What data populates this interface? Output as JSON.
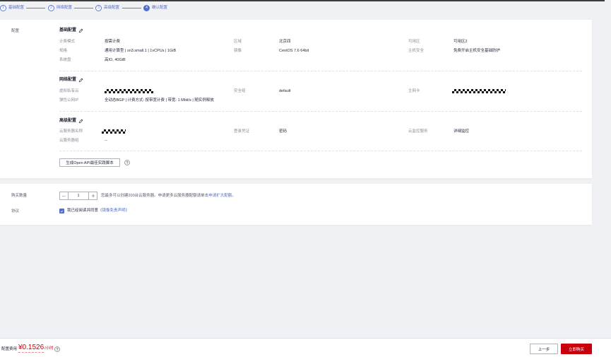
{
  "colors": {
    "page_bg": "#f0f1f5",
    "brand_blue": "#5e7ce0",
    "link": "#526ecc",
    "primary_red": "#c7000b",
    "text_main": "#252b3a",
    "text_label": "#8a8e99",
    "text_secondary": "#575d6c",
    "border": "#adb0b8",
    "divider": "#dfe1e6"
  },
  "icons": {
    "edit": "pencil-icon",
    "help": "question-circle-icon",
    "minus": "minus-icon",
    "plus": "plus-icon",
    "check": "check-icon"
  },
  "wizard": {
    "steps": [
      {
        "number": "1",
        "label": "基础配置",
        "active": false
      },
      {
        "number": "2",
        "label": "网络配置",
        "active": false
      },
      {
        "number": "3",
        "label": "高级配置",
        "active": false
      },
      {
        "number": "4",
        "label": "确认配置",
        "active": true
      }
    ]
  },
  "summary": {
    "label": "配置",
    "basic": {
      "title": "基础配置",
      "billing_mode": {
        "label": "计费模式",
        "value": "按需计费"
      },
      "region": {
        "label": "区域",
        "value": "北京四"
      },
      "az": {
        "label": "可用区",
        "value": "可用区2"
      },
      "flavor": {
        "label": "规格",
        "value": "通用计算型 | sn3.small.1 | 1vCPUs | 1GiB"
      },
      "image": {
        "label": "镜像",
        "value": "CentOS 7.6 64bit"
      },
      "host_security": {
        "label": "主机安全",
        "value": "免费开启主机安全基础防护"
      },
      "system_disk": {
        "label": "系统盘",
        "value": "高IO, 40GiB"
      }
    },
    "network": {
      "title": "网络配置",
      "vpc": {
        "label": "虚拟私有云"
      },
      "security_group": {
        "label": "安全组",
        "value": "default"
      },
      "primary_nic": {
        "label": "主网卡"
      },
      "eip": {
        "label": "弹性公网IP",
        "value": "全动态BGP | 计费方式: 按带宽计费 | 带宽: 1 Mbit/s | 随实例释放"
      }
    },
    "advanced": {
      "title": "高级配置",
      "server_name": {
        "label": "云服务器名称"
      },
      "login": {
        "label": "登录凭证",
        "value": "密码"
      },
      "monitoring": {
        "label": "云监控服务",
        "value": "详细监控"
      },
      "server_group": {
        "label": "云服务器组",
        "value": "--"
      }
    },
    "openapi_button": "生成Open API最佳实践脚本"
  },
  "purchase": {
    "quantity": {
      "label": "购买数量",
      "value": "1",
      "hint_prefix": "您最多可以创建200台云服务器。申请更多云服务器配额请单击",
      "hint_link": "申请扩大配额",
      "hint_suffix": "。"
    },
    "agreement": {
      "label": "协议",
      "checked": true,
      "text": "我已经阅读并同意",
      "link": "《镜像免责声明》"
    }
  },
  "footer": {
    "price_label": "配置费用",
    "price": "¥0.1526",
    "price_unit": "/小时",
    "prev_button": "上一步",
    "buy_button": "立即购买"
  }
}
